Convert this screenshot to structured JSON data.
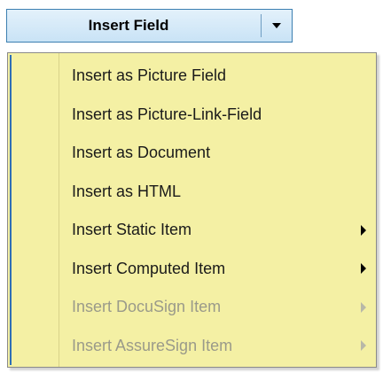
{
  "button": {
    "label": "Insert Field",
    "dropdown_icon": "chevron-down-icon"
  },
  "menu": {
    "items": [
      {
        "label": "Insert as Picture Field",
        "enabled": true,
        "has_submenu": false
      },
      {
        "label": "Insert as Picture-Link-Field",
        "enabled": true,
        "has_submenu": false
      },
      {
        "label": "Insert as Document",
        "enabled": true,
        "has_submenu": false
      },
      {
        "label": "Insert as HTML",
        "enabled": true,
        "has_submenu": false
      },
      {
        "label": "Insert Static Item",
        "enabled": true,
        "has_submenu": true
      },
      {
        "label": "Insert Computed Item",
        "enabled": true,
        "has_submenu": true
      },
      {
        "label": "Insert DocuSign Item",
        "enabled": false,
        "has_submenu": true
      },
      {
        "label": "Insert AssureSign Item",
        "enabled": false,
        "has_submenu": true
      }
    ]
  },
  "colors": {
    "menu_background": "#f4f0a4",
    "button_border": "#3c7fb1",
    "disabled_text": "#9a9a8a"
  }
}
